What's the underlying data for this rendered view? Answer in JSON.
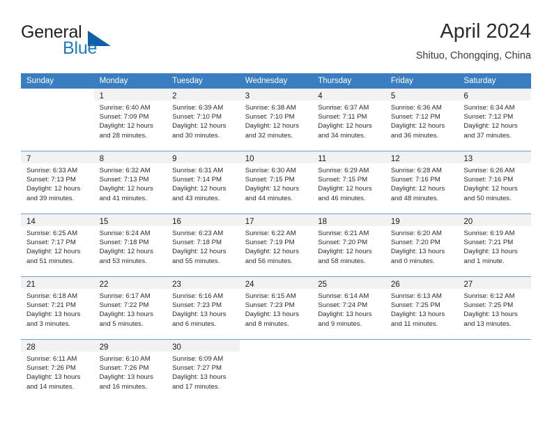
{
  "brand": {
    "name_part1": "General",
    "name_part2": "Blue",
    "triangle_icon": "brand-triangle-icon"
  },
  "header": {
    "title": "April 2024",
    "subtitle": "Shituo, Chongqing, China"
  },
  "weekday_headers": [
    "Sunday",
    "Monday",
    "Tuesday",
    "Wednesday",
    "Thursday",
    "Friday",
    "Saturday"
  ],
  "colors": {
    "header_blue": "#3a7ec1",
    "grid_line": "#6f9ec9",
    "daynum_band": "#f2f2f2",
    "brand_blue": "#1c7cc0",
    "brand_triangle": "#1060a8"
  },
  "weeks": [
    [
      {
        "day": "",
        "sunrise": "",
        "sunset": "",
        "daylight": "",
        "empty": true
      },
      {
        "day": "1",
        "sunrise": "Sunrise: 6:40 AM",
        "sunset": "Sunset: 7:09 PM",
        "daylight_line1": "Daylight: 12 hours",
        "daylight_line2": "and 28 minutes."
      },
      {
        "day": "2",
        "sunrise": "Sunrise: 6:39 AM",
        "sunset": "Sunset: 7:10 PM",
        "daylight_line1": "Daylight: 12 hours",
        "daylight_line2": "and 30 minutes."
      },
      {
        "day": "3",
        "sunrise": "Sunrise: 6:38 AM",
        "sunset": "Sunset: 7:10 PM",
        "daylight_line1": "Daylight: 12 hours",
        "daylight_line2": "and 32 minutes."
      },
      {
        "day": "4",
        "sunrise": "Sunrise: 6:37 AM",
        "sunset": "Sunset: 7:11 PM",
        "daylight_line1": "Daylight: 12 hours",
        "daylight_line2": "and 34 minutes."
      },
      {
        "day": "5",
        "sunrise": "Sunrise: 6:36 AM",
        "sunset": "Sunset: 7:12 PM",
        "daylight_line1": "Daylight: 12 hours",
        "daylight_line2": "and 36 minutes."
      },
      {
        "day": "6",
        "sunrise": "Sunrise: 6:34 AM",
        "sunset": "Sunset: 7:12 PM",
        "daylight_line1": "Daylight: 12 hours",
        "daylight_line2": "and 37 minutes."
      }
    ],
    [
      {
        "day": "7",
        "sunrise": "Sunrise: 6:33 AM",
        "sunset": "Sunset: 7:13 PM",
        "daylight_line1": "Daylight: 12 hours",
        "daylight_line2": "and 39 minutes."
      },
      {
        "day": "8",
        "sunrise": "Sunrise: 6:32 AM",
        "sunset": "Sunset: 7:13 PM",
        "daylight_line1": "Daylight: 12 hours",
        "daylight_line2": "and 41 minutes."
      },
      {
        "day": "9",
        "sunrise": "Sunrise: 6:31 AM",
        "sunset": "Sunset: 7:14 PM",
        "daylight_line1": "Daylight: 12 hours",
        "daylight_line2": "and 43 minutes."
      },
      {
        "day": "10",
        "sunrise": "Sunrise: 6:30 AM",
        "sunset": "Sunset: 7:15 PM",
        "daylight_line1": "Daylight: 12 hours",
        "daylight_line2": "and 44 minutes."
      },
      {
        "day": "11",
        "sunrise": "Sunrise: 6:29 AM",
        "sunset": "Sunset: 7:15 PM",
        "daylight_line1": "Daylight: 12 hours",
        "daylight_line2": "and 46 minutes."
      },
      {
        "day": "12",
        "sunrise": "Sunrise: 6:28 AM",
        "sunset": "Sunset: 7:16 PM",
        "daylight_line1": "Daylight: 12 hours",
        "daylight_line2": "and 48 minutes."
      },
      {
        "day": "13",
        "sunrise": "Sunrise: 6:26 AM",
        "sunset": "Sunset: 7:16 PM",
        "daylight_line1": "Daylight: 12 hours",
        "daylight_line2": "and 50 minutes."
      }
    ],
    [
      {
        "day": "14",
        "sunrise": "Sunrise: 6:25 AM",
        "sunset": "Sunset: 7:17 PM",
        "daylight_line1": "Daylight: 12 hours",
        "daylight_line2": "and 51 minutes."
      },
      {
        "day": "15",
        "sunrise": "Sunrise: 6:24 AM",
        "sunset": "Sunset: 7:18 PM",
        "daylight_line1": "Daylight: 12 hours",
        "daylight_line2": "and 53 minutes."
      },
      {
        "day": "16",
        "sunrise": "Sunrise: 6:23 AM",
        "sunset": "Sunset: 7:18 PM",
        "daylight_line1": "Daylight: 12 hours",
        "daylight_line2": "and 55 minutes."
      },
      {
        "day": "17",
        "sunrise": "Sunrise: 6:22 AM",
        "sunset": "Sunset: 7:19 PM",
        "daylight_line1": "Daylight: 12 hours",
        "daylight_line2": "and 56 minutes."
      },
      {
        "day": "18",
        "sunrise": "Sunrise: 6:21 AM",
        "sunset": "Sunset: 7:20 PM",
        "daylight_line1": "Daylight: 12 hours",
        "daylight_line2": "and 58 minutes."
      },
      {
        "day": "19",
        "sunrise": "Sunrise: 6:20 AM",
        "sunset": "Sunset: 7:20 PM",
        "daylight_line1": "Daylight: 13 hours",
        "daylight_line2": "and 0 minutes."
      },
      {
        "day": "20",
        "sunrise": "Sunrise: 6:19 AM",
        "sunset": "Sunset: 7:21 PM",
        "daylight_line1": "Daylight: 13 hours",
        "daylight_line2": "and 1 minute."
      }
    ],
    [
      {
        "day": "21",
        "sunrise": "Sunrise: 6:18 AM",
        "sunset": "Sunset: 7:21 PM",
        "daylight_line1": "Daylight: 13 hours",
        "daylight_line2": "and 3 minutes."
      },
      {
        "day": "22",
        "sunrise": "Sunrise: 6:17 AM",
        "sunset": "Sunset: 7:22 PM",
        "daylight_line1": "Daylight: 13 hours",
        "daylight_line2": "and 5 minutes."
      },
      {
        "day": "23",
        "sunrise": "Sunrise: 6:16 AM",
        "sunset": "Sunset: 7:23 PM",
        "daylight_line1": "Daylight: 13 hours",
        "daylight_line2": "and 6 minutes."
      },
      {
        "day": "24",
        "sunrise": "Sunrise: 6:15 AM",
        "sunset": "Sunset: 7:23 PM",
        "daylight_line1": "Daylight: 13 hours",
        "daylight_line2": "and 8 minutes."
      },
      {
        "day": "25",
        "sunrise": "Sunrise: 6:14 AM",
        "sunset": "Sunset: 7:24 PM",
        "daylight_line1": "Daylight: 13 hours",
        "daylight_line2": "and 9 minutes."
      },
      {
        "day": "26",
        "sunrise": "Sunrise: 6:13 AM",
        "sunset": "Sunset: 7:25 PM",
        "daylight_line1": "Daylight: 13 hours",
        "daylight_line2": "and 11 minutes."
      },
      {
        "day": "27",
        "sunrise": "Sunrise: 6:12 AM",
        "sunset": "Sunset: 7:25 PM",
        "daylight_line1": "Daylight: 13 hours",
        "daylight_line2": "and 13 minutes."
      }
    ],
    [
      {
        "day": "28",
        "sunrise": "Sunrise: 6:11 AM",
        "sunset": "Sunset: 7:26 PM",
        "daylight_line1": "Daylight: 13 hours",
        "daylight_line2": "and 14 minutes."
      },
      {
        "day": "29",
        "sunrise": "Sunrise: 6:10 AM",
        "sunset": "Sunset: 7:26 PM",
        "daylight_line1": "Daylight: 13 hours",
        "daylight_line2": "and 16 minutes."
      },
      {
        "day": "30",
        "sunrise": "Sunrise: 6:09 AM",
        "sunset": "Sunset: 7:27 PM",
        "daylight_line1": "Daylight: 13 hours",
        "daylight_line2": "and 17 minutes."
      },
      {
        "day": "",
        "sunrise": "",
        "sunset": "",
        "daylight": "",
        "empty": true
      },
      {
        "day": "",
        "sunrise": "",
        "sunset": "",
        "daylight": "",
        "empty": true
      },
      {
        "day": "",
        "sunrise": "",
        "sunset": "",
        "daylight": "",
        "empty": true
      },
      {
        "day": "",
        "sunrise": "",
        "sunset": "",
        "daylight": "",
        "empty": true
      }
    ]
  ]
}
